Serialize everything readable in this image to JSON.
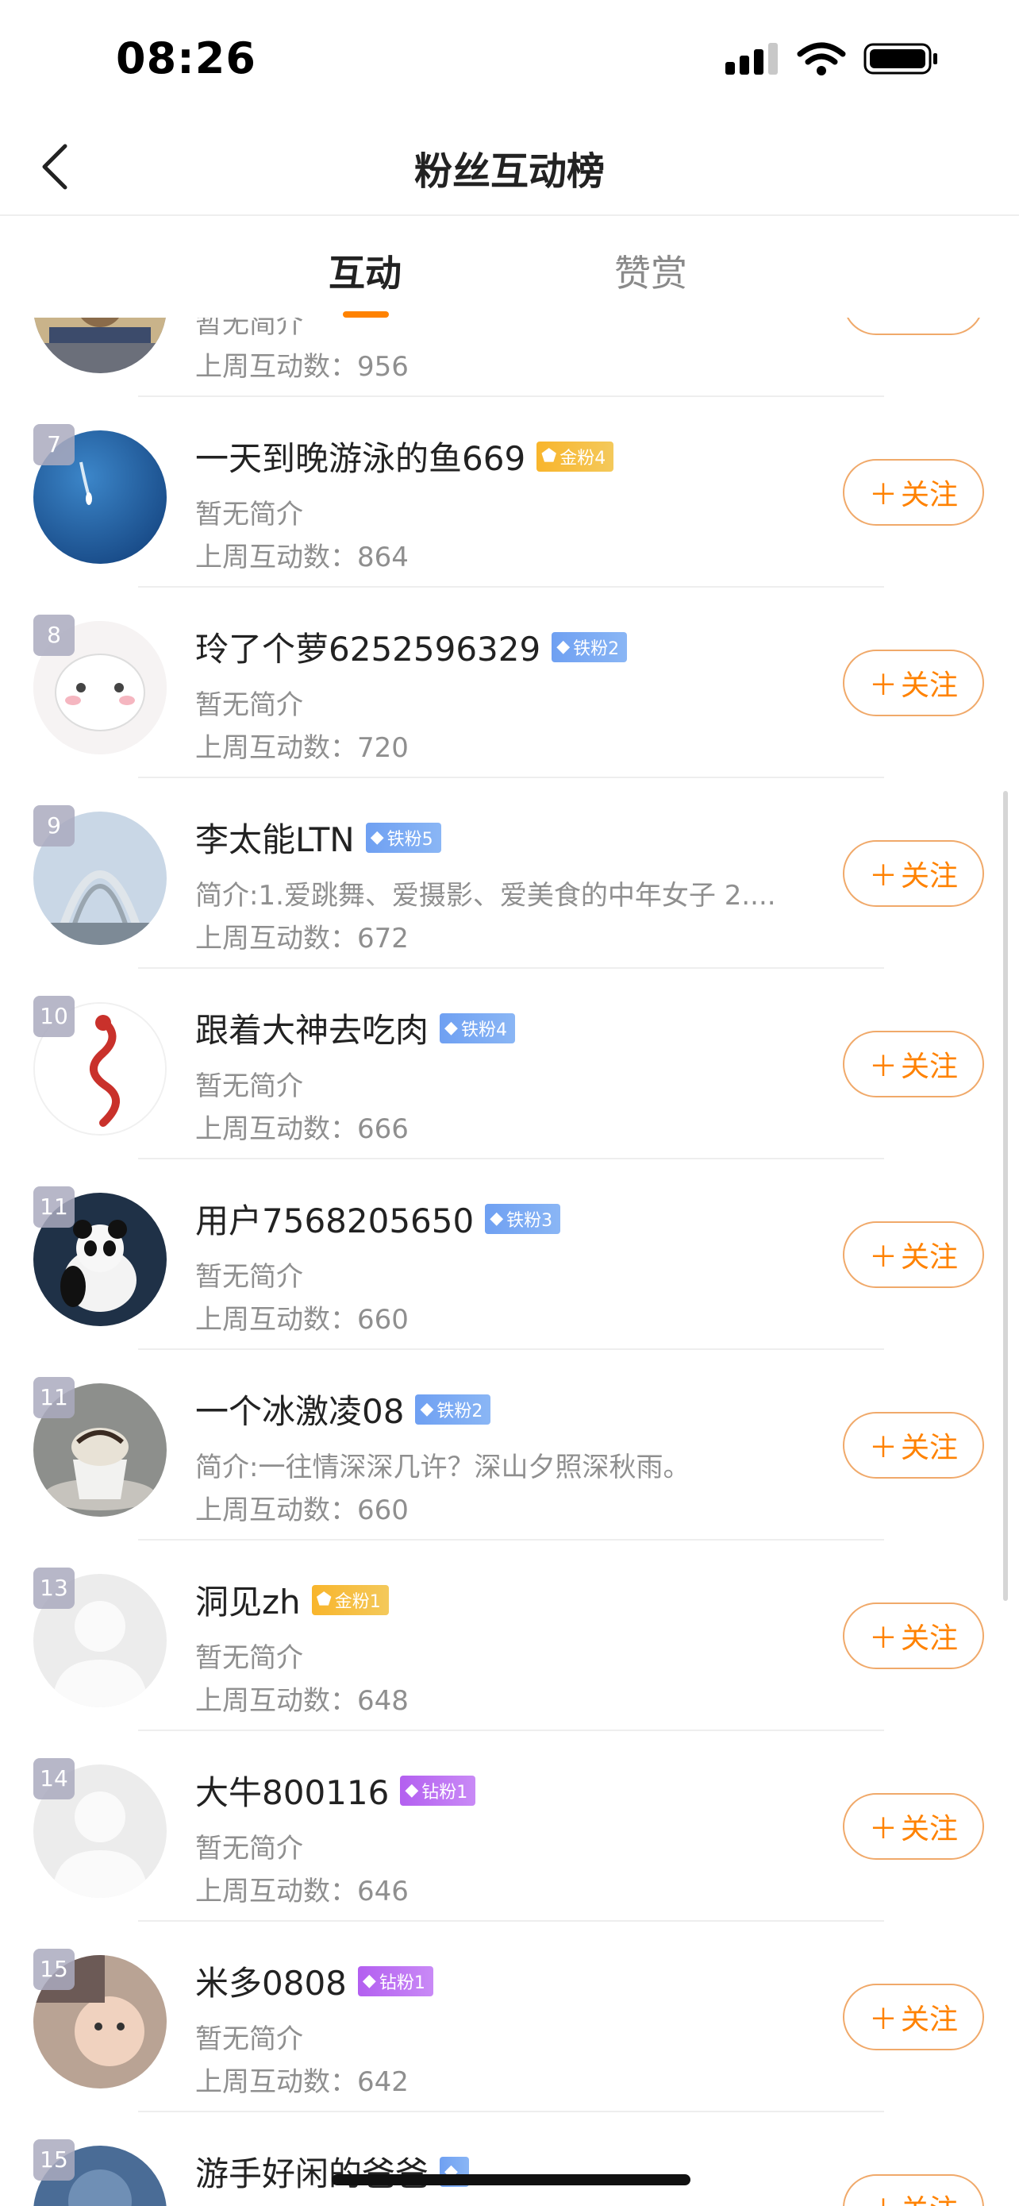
{
  "status_bar": {
    "time": "08:26"
  },
  "nav": {
    "title": "粉丝互动榜"
  },
  "tabs": [
    {
      "label": "互动",
      "active": true
    },
    {
      "label": "赞赏",
      "active": false
    }
  ],
  "follow_label": "关注",
  "rows": [
    {
      "rank": "",
      "name": "",
      "badge": null,
      "bio": "暂无简介",
      "stat": "上周互动数：956",
      "avatar": "ornate-photo"
    },
    {
      "rank": "7",
      "name": "一天到晚游泳的鱼669",
      "badge": {
        "label": "金粉4",
        "type": "gold"
      },
      "bio": "暂无简介",
      "stat": "上周互动数：864",
      "avatar": "ocean-boat"
    },
    {
      "rank": "8",
      "name": "玲了个萝6252596329",
      "badge": {
        "label": "铁粉2",
        "type": "iron"
      },
      "bio": "暂无简介",
      "stat": "上周互动数：720",
      "avatar": "cute-cartoon"
    },
    {
      "rank": "9",
      "name": "李太能LTN",
      "badge": {
        "label": "铁粉5",
        "type": "iron"
      },
      "bio": "简介:1.爱跳舞、爱摄影、爱美食的中年女子 2....",
      "stat": "上周互动数：672",
      "avatar": "bridge-arch"
    },
    {
      "rank": "10",
      "name": "跟着大神去吃肉",
      "badge": {
        "label": "铁粉4",
        "type": "iron"
      },
      "bio": "暂无简介",
      "stat": "上周互动数：666",
      "avatar": "red-dragon"
    },
    {
      "rank": "11",
      "name": "用户7568205650",
      "badge": {
        "label": "铁粉3",
        "type": "iron"
      },
      "bio": "暂无简介",
      "stat": "上周互动数：660",
      "avatar": "panda"
    },
    {
      "rank": "11",
      "name": "一个冰激凌08",
      "badge": {
        "label": "铁粉2",
        "type": "iron"
      },
      "bio": "简介:一往情深深几许？深山夕照深秋雨。",
      "stat": "上周互动数：660",
      "avatar": "coffee-cup"
    },
    {
      "rank": "13",
      "name": "洞见zh",
      "badge": {
        "label": "金粉1",
        "type": "gold"
      },
      "bio": "暂无简介",
      "stat": "上周互动数：648",
      "avatar": "default-user"
    },
    {
      "rank": "14",
      "name": "大牛800116",
      "badge": {
        "label": "钻粉1",
        "type": "diamond"
      },
      "bio": "暂无简介",
      "stat": "上周互动数：646",
      "avatar": "default-user"
    },
    {
      "rank": "15",
      "name": "米多0808",
      "badge": {
        "label": "钻粉1",
        "type": "diamond"
      },
      "bio": "暂无简介",
      "stat": "上周互动数：642",
      "avatar": "baby-photo"
    },
    {
      "rank": "15",
      "name": "游手好闲的爸爸",
      "badge": {
        "label": "",
        "type": "iron"
      },
      "bio": "",
      "stat": "",
      "avatar": "blue-photo"
    }
  ]
}
